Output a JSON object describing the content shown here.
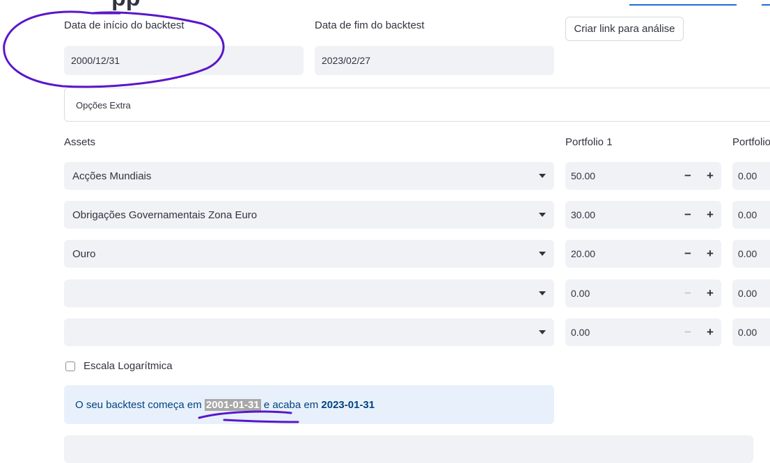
{
  "header": {
    "title_fragment": "pp"
  },
  "dates": {
    "start_label": "Data de início do backtest",
    "start_value": "2000/12/31",
    "end_label": "Data de fim do backtest",
    "end_value": "2023/02/27"
  },
  "link_button_label": "Criar link para análise",
  "extra_options_label": "Opções Extra",
  "assets_header": "Assets",
  "portfolio_headers": [
    "Portfolio 1",
    "Portfolio"
  ],
  "rows": [
    {
      "asset": "Acções Mundiais",
      "p1": "50.00",
      "p2": "0.00"
    },
    {
      "asset": "Obrigações Governamentais Zona Euro",
      "p1": "30.00",
      "p2": "0.00"
    },
    {
      "asset": "Ouro",
      "p1": "20.00",
      "p2": "0.00"
    },
    {
      "asset": "",
      "p1": "0.00",
      "p2": "0.00"
    },
    {
      "asset": "",
      "p1": "0.00",
      "p2": "0.00"
    }
  ],
  "stepper": {
    "minus": "−",
    "plus": "+"
  },
  "log_scale_label": "Escala Logarítmica",
  "info": {
    "prefix": "O seu backtest começa em",
    "start": "2001-01-31",
    "middle": "e acaba em",
    "end": "2023-01-31"
  },
  "annotation_color": "#5a16c9"
}
